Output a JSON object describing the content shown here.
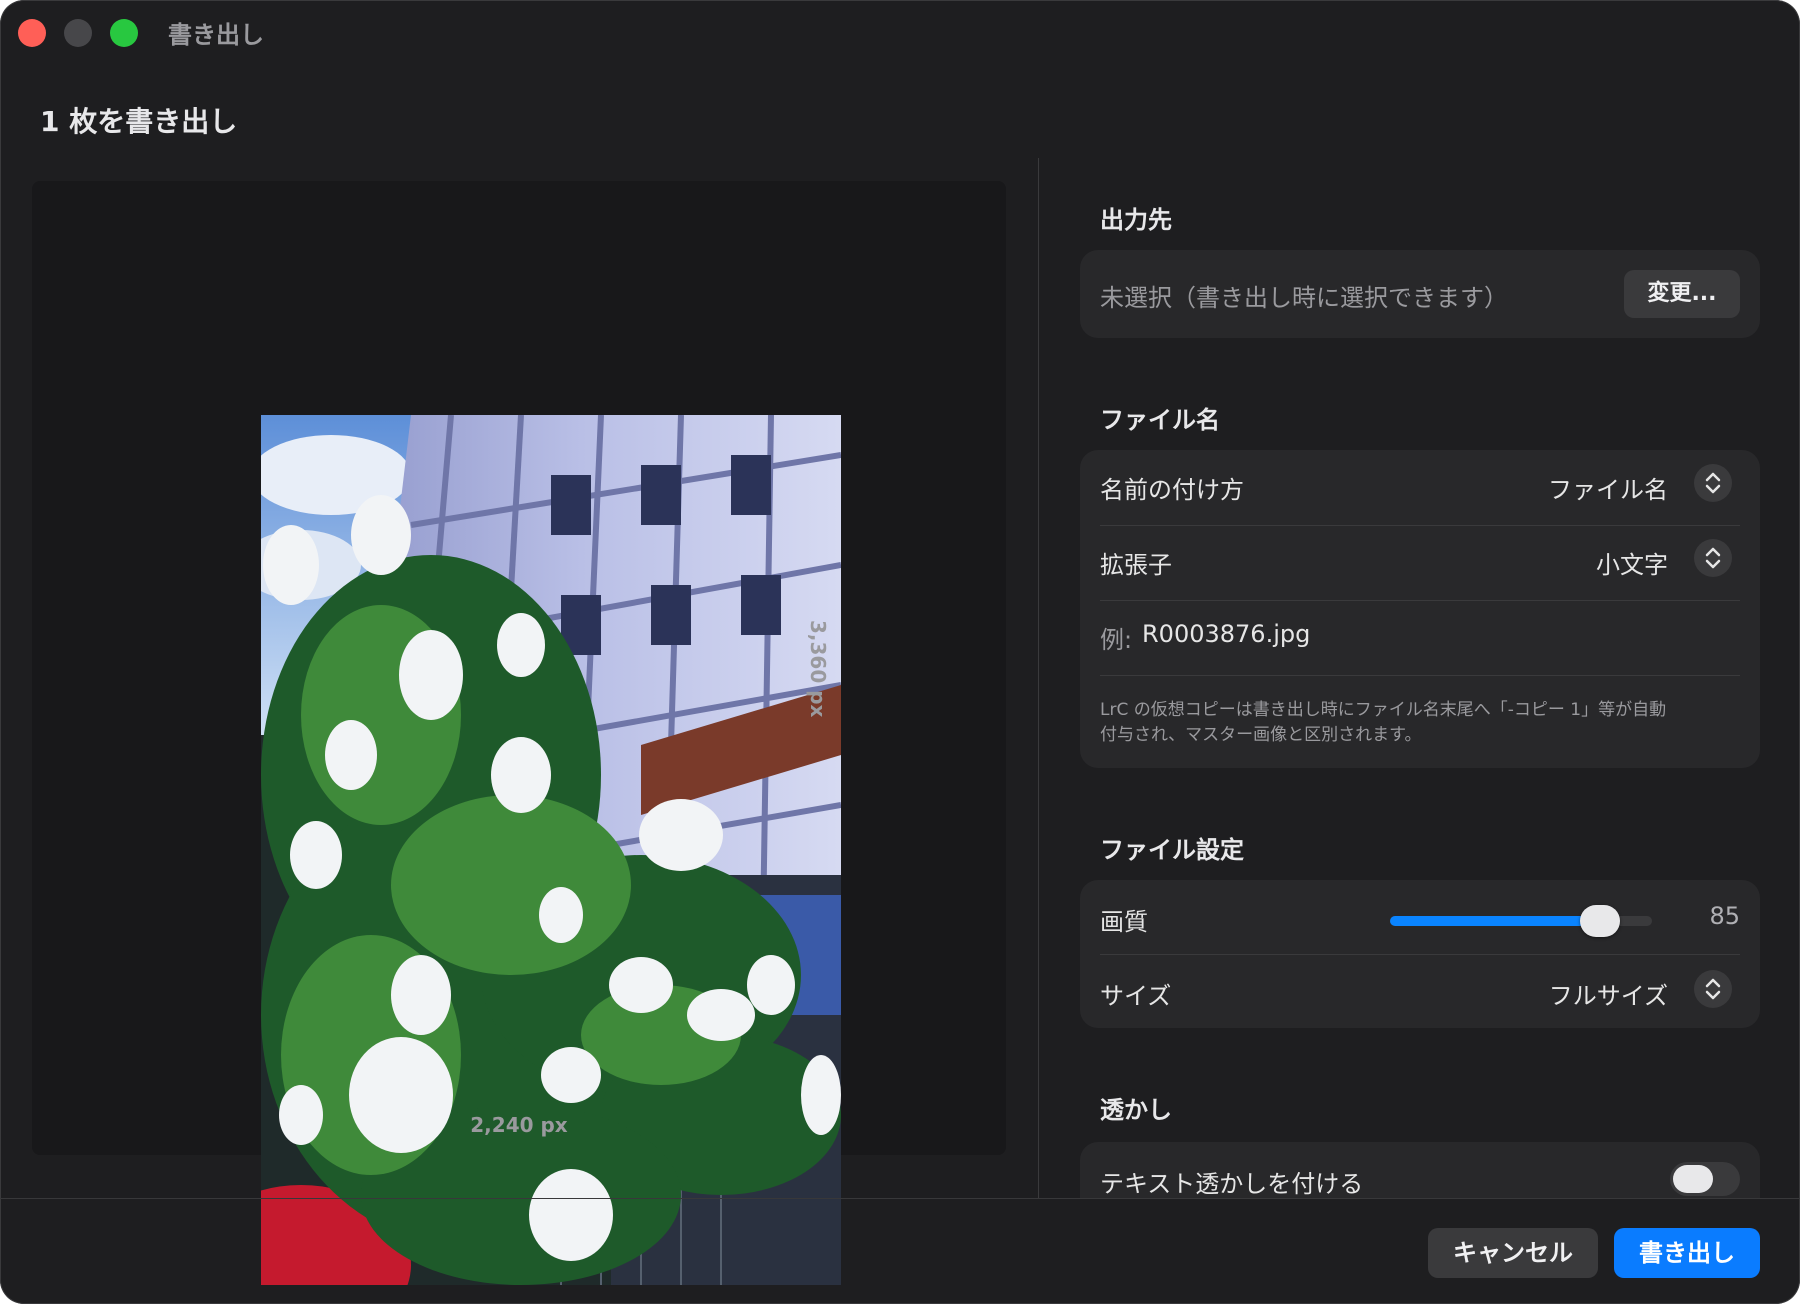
{
  "window": {
    "title": "書き出し"
  },
  "dialog": {
    "title": "1 枚を書き出し"
  },
  "preview": {
    "width_label": "2,240 px",
    "height_label": "3,360 px"
  },
  "destination": {
    "heading": "出力先",
    "value": "未選択（書き出し時に選択できます）",
    "change_label": "変更..."
  },
  "filename": {
    "heading": "ファイル名",
    "naming_label": "名前の付け方",
    "naming_value": "ファイル名",
    "extension_label": "拡張子",
    "extension_value": "小文字",
    "example_label": "例:",
    "example_value": "R0003876.jpg",
    "note_line1": "LrC の仮想コピーは書き出し時にファイル名末尾へ「-コピー 1」等が自動",
    "note_line2": "付与され、マスター画像と区別されます。"
  },
  "file_settings": {
    "heading": "ファイル設定",
    "quality_label": "画質",
    "quality_value": "85",
    "quality_fraction": 0.8,
    "size_label": "サイズ",
    "size_value": "フルサイズ"
  },
  "watermark": {
    "heading": "透かし",
    "text_label": "テキスト透かしを付ける",
    "enabled": false
  },
  "footer": {
    "cancel_label": "キャンセル",
    "export_label": "書き出し"
  },
  "colors": {
    "accent": "#0a84ff",
    "background": "#1e1e20",
    "card": "#28282a"
  }
}
